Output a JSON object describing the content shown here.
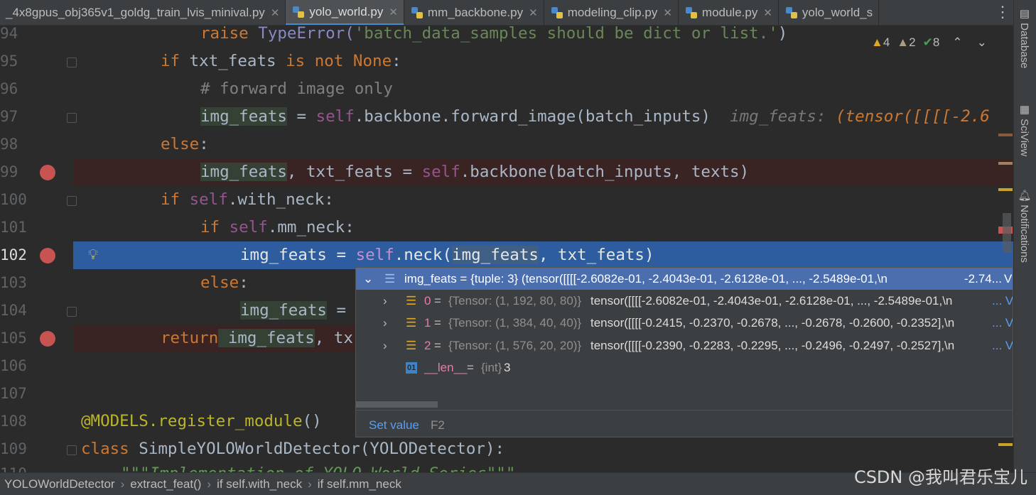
{
  "tabs": [
    {
      "label": "_4x8gpus_obj365v1_goldg_train_lvis_minival.py",
      "active": false,
      "icon": false
    },
    {
      "label": "yolo_world.py",
      "active": true,
      "icon": true
    },
    {
      "label": "mm_backbone.py",
      "active": false,
      "icon": true
    },
    {
      "label": "modeling_clip.py",
      "active": false,
      "icon": true
    },
    {
      "label": "module.py",
      "active": false,
      "icon": true
    },
    {
      "label": "yolo_world_s",
      "active": false,
      "icon": true
    }
  ],
  "right_tools": [
    "Database",
    "SciView",
    "Notifications"
  ],
  "inspections": {
    "warnings": "4",
    "weak_warnings": "2",
    "ok": "8"
  },
  "lines": [
    {
      "n": "94"
    },
    {
      "n": "95"
    },
    {
      "n": "96"
    },
    {
      "n": "97"
    },
    {
      "n": "98"
    },
    {
      "n": "99"
    },
    {
      "n": "100"
    },
    {
      "n": "101"
    },
    {
      "n": "102"
    },
    {
      "n": "103"
    },
    {
      "n": "104"
    },
    {
      "n": "105"
    },
    {
      "n": "106"
    },
    {
      "n": "107"
    },
    {
      "n": "108"
    },
    {
      "n": "109"
    },
    {
      "n": "110"
    }
  ],
  "code": {
    "l94_kw": "raise",
    "l94_cls": " TypeError(",
    "l94_str": "'batch_data_samples should be dict or list.'",
    "l94_end": ")",
    "l95_kw": "if",
    "l95_a": " txt_feats ",
    "l95_kw2": "is not",
    "l95_kw3": " None",
    "l95_end": ":",
    "l96_cm": "# forward image only",
    "l97_var": "img_feats",
    "l97_a": " = ",
    "l97_self": "self",
    "l97_b": ".backbone.forward_image(batch_inputs)",
    "l97_hint": "img_feats: ",
    "l97_hintv": "(tensor([[[[-2.6",
    "l98_kw": "else",
    "l98_end": ":",
    "l99_var": "img_feats",
    "l99_a": ", txt_feats = ",
    "l99_self": "self",
    "l99_b": ".backbone(batch_inputs, texts)",
    "l100_kw": "if",
    "l100_self": " self",
    "l100_b": ".with_neck:",
    "l101_kw": "if",
    "l101_self": " self",
    "l101_b": ".mm_neck:",
    "l102_a": "img_feats = ",
    "l102_self": "self",
    "l102_b": ".neck(",
    "l102_var": "img_feats",
    "l102_c": ", txt_feats)",
    "l103_kw": "else",
    "l103_end": ":",
    "l104_var": "img_feats",
    "l104_a": " = ",
    "l105_kw": "return",
    "l105_var": " img_feats",
    "l105_a": ", tx",
    "l108_dec": "@MODELS.register_module",
    "l108_end": "()",
    "l109_kw": "class",
    "l109_a": " SimpleYOLOWorldDetector(YOLODetector):",
    "l110_doc": "\"\"\"Implementation of YOLO World Series\"\"\""
  },
  "popup": {
    "root_label": "img_feats = {tuple: 3} (tensor([[[[-2.6082e-01, -2.4043e-01, -2.6128e-01,  ..., -2.5489e-01,\\n",
    "root_right": "-2.74...",
    "view": "View",
    "items": [
      {
        "idx": "0",
        "type": "{Tensor: (1, 192, 80, 80)}",
        "val": "tensor([[[[-2.6082e-01, -2.4043e-01, -2.6128e-01,  ..., -2.5489e-01,\\n",
        "view": "... View"
      },
      {
        "idx": "1",
        "type": "{Tensor: (1, 384, 40, 40)}",
        "val": "tensor([[[[-0.2415, -0.2370, -0.2678,  ..., -0.2678, -0.2600, -0.2352],\\n",
        "view": "... View"
      },
      {
        "idx": "2",
        "type": "{Tensor: (1, 576, 20, 20)}",
        "val": "tensor([[[[-0.2390, -0.2283, -0.2295,  ..., -0.2496, -0.2497, -0.2527],\\n",
        "view": "... View"
      }
    ],
    "len_name": "__len__",
    "len_eq": " = ",
    "len_type": "{int}",
    "len_val": " 3",
    "set_value": "Set value",
    "shortcut": "F2"
  },
  "breadcrumb": [
    "YOLOWorldDetector",
    "extract_feat()",
    "if self.with_neck",
    "if self.mm_neck"
  ],
  "watermark": "CSDN @我叫君乐宝儿",
  "colors": {
    "breakpoint": "#c75450",
    "current_line": "#2d5d9e",
    "bp_line": "#3a2323"
  }
}
